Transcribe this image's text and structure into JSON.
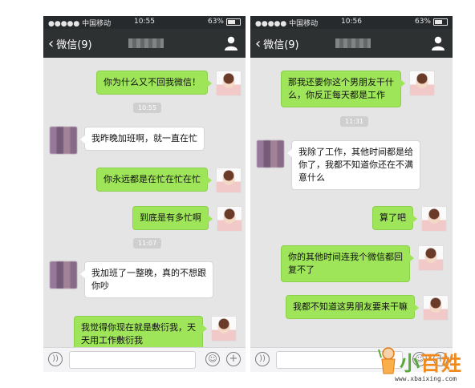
{
  "left_screen": {
    "status": {
      "carrier": "●●●●● 中国移动",
      "time": "10:55",
      "battery": "63%"
    },
    "nav": {
      "back_label": "微信(9)"
    },
    "messages": [
      {
        "side": "out",
        "text": "你为什么又不回我微信！"
      },
      {
        "timestamp": "10:55"
      },
      {
        "side": "in",
        "text": "我昨晚加班啊，就一直在忙"
      },
      {
        "side": "out",
        "text": "你永远都是在忙在忙在忙"
      },
      {
        "side": "out",
        "text": "到底是有多忙啊"
      },
      {
        "timestamp": "11:07"
      },
      {
        "side": "in",
        "text_lines": [
          "我加班了一整晚，真的不想跟",
          "你吵"
        ]
      },
      {
        "side": "out",
        "text_lines": [
          "我觉得你现在就是敷衍我，天",
          "天用工作敷衍我"
        ]
      }
    ]
  },
  "right_screen": {
    "status": {
      "carrier": "●●●●● 中国移动",
      "time": "10:56",
      "battery": "63%"
    },
    "nav": {
      "back_label": "微信(9)"
    },
    "messages": [
      {
        "side": "out",
        "text_lines": [
          "那我还要你这个男朋友干什",
          "么，你反正每天都是工作"
        ]
      },
      {
        "timestamp": "11:31"
      },
      {
        "side": "in",
        "text_lines": [
          "我除了工作，其他时间都是给",
          "你了，我都不知道你还在不满",
          "意什么"
        ]
      },
      {
        "side": "out",
        "text": "算了吧"
      },
      {
        "side": "out",
        "text_lines": [
          "你的其他时间连我个微信都回",
          "复不了"
        ]
      },
      {
        "side": "out",
        "text": "我都不知道这男朋友要来干嘛"
      }
    ]
  },
  "input_bar": {
    "voice_icon": "voice-icon",
    "emoji_icon": "emoji-icon",
    "add_icon": "plus-icon"
  },
  "watermark": {
    "brand_part1": "小",
    "brand_part2": "百姓",
    "url": "www.xbaixing.com"
  },
  "colors": {
    "out_bubble": "#9fe55a",
    "in_bubble": "#ffffff",
    "nav_bar": "#2e3132",
    "chat_bg": "#e5e5e5"
  }
}
